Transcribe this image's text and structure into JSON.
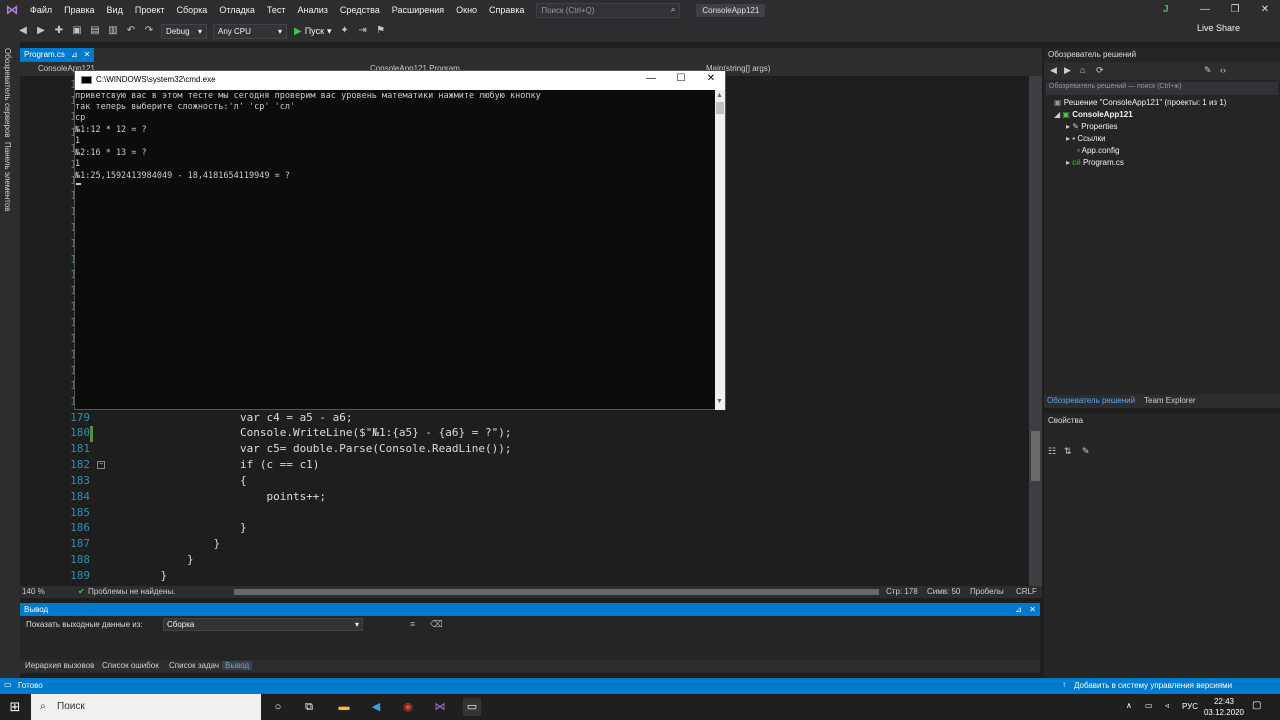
{
  "menu": {
    "items": [
      "Файл",
      "Правка",
      "Вид",
      "Проект",
      "Сборка",
      "Отладка",
      "Тест",
      "Анализ",
      "Средства",
      "Расширения",
      "Окно",
      "Справка"
    ],
    "search_placeholder": "Поиск (Ctrl+Q)",
    "app_title": "ConsoleApp121",
    "user_initial": "J"
  },
  "toolbar": {
    "config": "Debug",
    "platform": "Any CPU",
    "run_label": "Пуск",
    "live_share": "Live Share"
  },
  "left_tabs": [
    "Обозреватель серверов",
    "Панель элементов"
  ],
  "editor": {
    "tab_file": "Program.cs",
    "nav_project": "ConsoleApp121",
    "nav_class": "ConsoleApp121.Program",
    "nav_method": "Main(string[] args)",
    "lines": [
      {
        "n": "158",
        "code": ""
      },
      {
        "n": "159",
        "code": ""
      },
      {
        "n": "160",
        "code": ""
      },
      {
        "n": "161",
        "code": ""
      },
      {
        "n": "162",
        "code": ""
      },
      {
        "n": "163",
        "code": ""
      },
      {
        "n": "164",
        "code": ""
      },
      {
        "n": "165",
        "code": ""
      },
      {
        "n": "166",
        "code": ""
      },
      {
        "n": "167",
        "code": ""
      },
      {
        "n": "168",
        "code": ""
      },
      {
        "n": "169",
        "code": ""
      },
      {
        "n": "170",
        "code": ""
      },
      {
        "n": "171",
        "code": ""
      },
      {
        "n": "172",
        "code": ""
      },
      {
        "n": "173",
        "code": ""
      },
      {
        "n": "174",
        "code": ""
      },
      {
        "n": "175",
        "code": ""
      },
      {
        "n": "176",
        "code": ""
      },
      {
        "n": "177",
        "code": ""
      },
      {
        "n": "178",
        "code": ""
      },
      {
        "n": "179",
        "code": "                var c4 = a5 - a6;"
      },
      {
        "n": "180",
        "code": "                Console.WriteLine($\"№1:{a5} - {a6} = ?\");"
      },
      {
        "n": "181",
        "code": "                var c5= double.Parse(Console.ReadLine());"
      },
      {
        "n": "182",
        "code": "                if (c == c1)"
      },
      {
        "n": "183",
        "code": "                {"
      },
      {
        "n": "184",
        "code": "                    points++;"
      },
      {
        "n": "185",
        "code": ""
      },
      {
        "n": "186",
        "code": "                }"
      },
      {
        "n": "187",
        "code": "            }"
      },
      {
        "n": "188",
        "code": "        }"
      },
      {
        "n": "189",
        "code": "    }"
      }
    ],
    "zoom": "140 %",
    "problems": "Проблемы не найдены.",
    "line_pos": "Стр: 178",
    "col_pos": "Симв: 50",
    "spaces": "Пробелы",
    "eol": "CRLF"
  },
  "output": {
    "title": "Вывод",
    "show_from_label": "Показать выходные данные из:",
    "source": "Сборка"
  },
  "bottom_tabs": [
    "Иерархия вызовов",
    "Список ошибок",
    "Список задач",
    "Вывод"
  ],
  "solution_explorer": {
    "title": "Обозреватель решений",
    "search_placeholder": "Обозреватель решений — поиск (Ctrl+ж)",
    "solution": "Решение \"ConsoleApp121\" (проекты: 1 из 1)",
    "project": "ConsoleApp121",
    "items": [
      "Properties",
      "Ссылки",
      "App.config",
      "Program.cs"
    ],
    "tab_explorer": "Обозреватель решений",
    "tab_team": "Team Explorer"
  },
  "properties": {
    "title": "Свойства"
  },
  "status_bar": {
    "ready": "Готово",
    "vcs": "Добавить в систему управления версиями"
  },
  "taskbar": {
    "search": "Поиск",
    "lang": "РУС",
    "time": "22:43",
    "date": "03.12.2020"
  },
  "cmd": {
    "title": "C:\\WINDOWS\\system32\\cmd.exe",
    "lines": [
      "приветсвую вас в этом тесте мы сегодня проверим вас уровень математики нажмите любую кнопку",
      "так теперь выберите сложность:'л' 'ср' 'сл'",
      "ср",
      "№1:12 * 12 = ?",
      "1",
      "№2:16 * 13 = ?",
      "1",
      "№1:25,1592413984049 - 18,4181654119949 = ?"
    ]
  }
}
